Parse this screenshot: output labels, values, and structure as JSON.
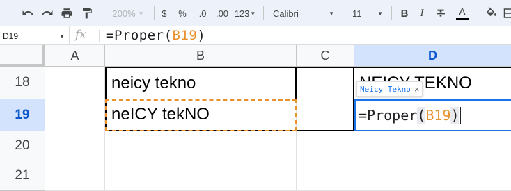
{
  "toolbar": {
    "zoom": "200%",
    "currency": "$",
    "percent": "%",
    "decrease_decimal": ".0",
    "increase_decimal": ".00",
    "more_formats": "123",
    "font": "Calibri",
    "font_size": "11",
    "bold": "B",
    "italic": "I",
    "text_color": "A"
  },
  "name_box": "D19",
  "formula_bar": {
    "fx": "fx",
    "prefix": "=Proper(",
    "ref": "B19",
    "suffix": ")"
  },
  "columns": [
    "A",
    "B",
    "C",
    "D"
  ],
  "rows": [
    "18",
    "19",
    "20",
    "21"
  ],
  "cells": {
    "B18": "neicy tekno",
    "B19": "neICY tekNO",
    "D18": "NEICY TEKNO"
  },
  "editor": {
    "prefix": "=Proper",
    "open_paren": "(",
    "ref": "B19",
    "close_paren": ")"
  },
  "tooltip": {
    "preview": "Neicy Tekno",
    "close": "×"
  },
  "colors": {
    "accent": "#1a73e8",
    "reference": "#e8912d",
    "header_active": "#d3e3fd"
  }
}
